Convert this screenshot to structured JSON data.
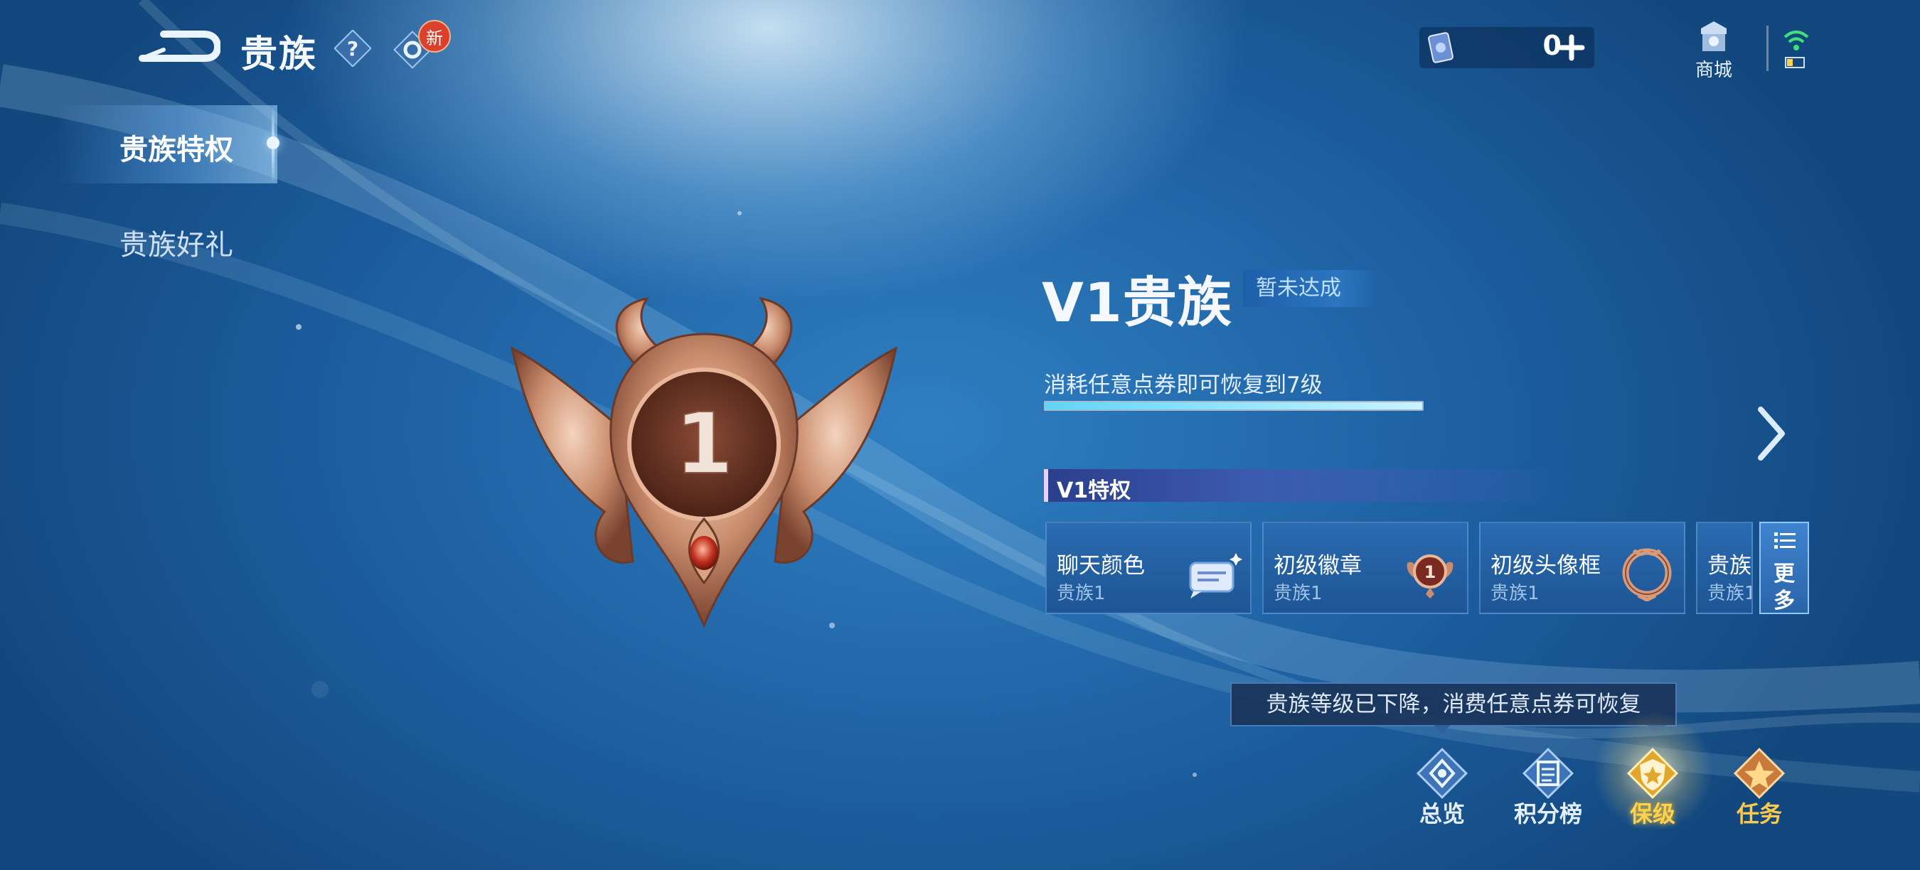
{
  "header": {
    "title": "贵族",
    "new_badge": "新",
    "currency_amount": "0",
    "shop_label": "商城"
  },
  "sidebar": {
    "items": [
      {
        "label": "贵族特权",
        "active": true
      },
      {
        "label": "贵族好礼",
        "active": false
      }
    ]
  },
  "emblem": {
    "level": "1"
  },
  "level_panel": {
    "title": "V1贵族",
    "status": "暂未达成",
    "progress_text": "消耗任意点券即可恢复到7级",
    "progress": 1.0,
    "privileges_header": "V1特权",
    "privileges": [
      {
        "name": "聊天颜色",
        "sub": "贵族1",
        "icon": "chat-bubble-icon"
      },
      {
        "name": "初级徽章",
        "sub": "贵族1",
        "icon": "badge-icon"
      },
      {
        "name": "初级头像框",
        "sub": "贵族1",
        "icon": "avatar-frame-icon"
      },
      {
        "name": "贵族",
        "sub": "贵族1",
        "icon": ""
      }
    ],
    "more_label_1": "更",
    "more_label_2": "多"
  },
  "tooltip": "贵族等级已下降，消费任意点券可恢复",
  "bottom_nav": [
    {
      "label": "总览",
      "icon": "overview-icon"
    },
    {
      "label": "积分榜",
      "icon": "leaderboard-icon"
    },
    {
      "label": "保级",
      "icon": "keep-level-icon",
      "active": true
    },
    {
      "label": "任务",
      "icon": "task-icon"
    }
  ],
  "colors": {
    "accent_gold": "#ffd24a",
    "bg_blue": "#1c5d9e",
    "progress_cyan": "#5fd6f6"
  }
}
